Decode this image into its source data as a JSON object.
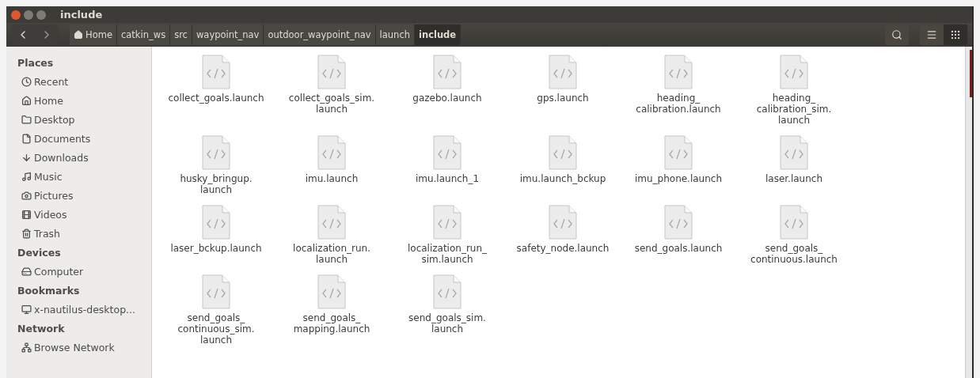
{
  "window": {
    "title": "include"
  },
  "breadcrumbs": [
    {
      "label": "Home",
      "selected": false
    },
    {
      "label": "catkin_ws",
      "selected": false
    },
    {
      "label": "src",
      "selected": false
    },
    {
      "label": "waypoint_nav",
      "selected": false
    },
    {
      "label": "outdoor_waypoint_nav",
      "selected": false
    },
    {
      "label": "launch",
      "selected": false
    },
    {
      "label": "include",
      "selected": true
    }
  ],
  "view_buttons": [
    {
      "kind": "list",
      "selected": false
    },
    {
      "kind": "grid",
      "selected": true
    }
  ],
  "sidebar": [
    {
      "heading": "Places",
      "items": [
        "Recent",
        "Home",
        "Desktop",
        "Documents",
        "Downloads",
        "Music",
        "Pictures",
        "Videos",
        "Trash"
      ]
    },
    {
      "heading": "Devices",
      "items": [
        "Computer"
      ]
    },
    {
      "heading": "Bookmarks",
      "items": [
        "x-nautilus-desktop..."
      ]
    },
    {
      "heading": "Network",
      "items": [
        "Browse Network"
      ]
    }
  ],
  "files": [
    {
      "lines": [
        "collect_goals.launch"
      ]
    },
    {
      "lines": [
        "collect_goals_sim.",
        "launch"
      ]
    },
    {
      "lines": [
        "gazebo.launch"
      ]
    },
    {
      "lines": [
        "gps.launch"
      ]
    },
    {
      "lines": [
        "heading_",
        "calibration.launch"
      ]
    },
    {
      "lines": [
        "heading_",
        "calibration_sim.",
        "launch"
      ]
    },
    {
      "lines": [
        "husky_bringup.",
        "launch"
      ]
    },
    {
      "lines": [
        "imu.launch"
      ]
    },
    {
      "lines": [
        "imu.launch_1"
      ]
    },
    {
      "lines": [
        "imu.launch_bckup"
      ]
    },
    {
      "lines": [
        "imu_phone.launch"
      ]
    },
    {
      "lines": [
        "laser.launch"
      ]
    },
    {
      "lines": [
        "laser_bckup.launch"
      ]
    },
    {
      "lines": [
        "localization_run.",
        "launch"
      ]
    },
    {
      "lines": [
        "localization_run_",
        "sim.launch"
      ]
    },
    {
      "lines": [
        "safety_node.launch"
      ]
    },
    {
      "lines": [
        "send_goals.launch"
      ]
    },
    {
      "lines": [
        "send_goals_",
        "continuous.launch"
      ]
    },
    {
      "lines": [
        "send_goals_",
        "continuous_sim.",
        "launch"
      ]
    },
    {
      "lines": [
        "send_goals_",
        "mapping.launch"
      ]
    },
    {
      "lines": [
        "send_goals_sim.",
        "launch"
      ]
    }
  ]
}
